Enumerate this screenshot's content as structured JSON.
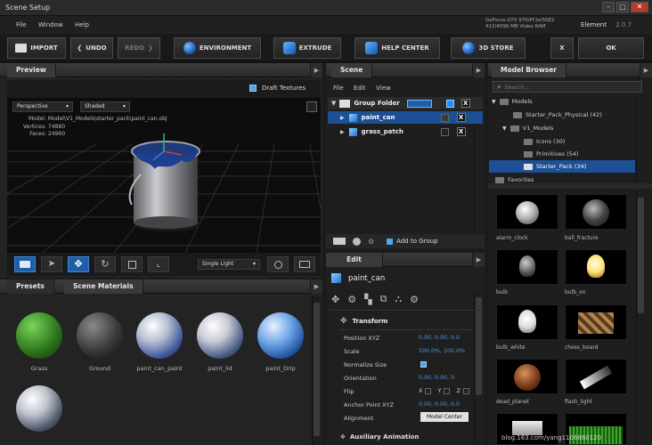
{
  "window": {
    "title": "Scene Setup"
  },
  "menu": [
    "File",
    "Window",
    "Help"
  ],
  "gpu_info": [
    "GeForce GTX 970/PCIe/SSE2",
    "412/4096 MB Video RAM"
  ],
  "app": {
    "element_label": "Element",
    "version": "2.0.7"
  },
  "toolbar": {
    "import": "IMPORT",
    "undo": "UNDO",
    "redo": "REDO",
    "environment": "ENVIRONMENT",
    "extrude": "EXTRUDE",
    "help_center": "HELP CENTER",
    "store": "3D STORE",
    "x": "X",
    "ok": "OK"
  },
  "preview": {
    "title": "Preview",
    "draft_textures": "Draft Textures",
    "projection": "Perspective",
    "shading": "Shaded",
    "model_label": "Model:",
    "model_value": "Model\\V1_Models\\starter_pack\\paint_can.obj",
    "vertices_label": "Vertices:",
    "vertices_value": "74880",
    "faces_label": "Faces:",
    "faces_value": "24960",
    "light": "Single Light"
  },
  "presets": {
    "tabs": [
      "Presets",
      "Scene Materials"
    ],
    "materials": [
      "Grass",
      "Ground",
      "paint_can_paint",
      "paint_lid",
      "paint_Drip"
    ]
  },
  "scene": {
    "title": "Scene",
    "menu": [
      "File",
      "Edit",
      "View"
    ],
    "group": "Group Folder",
    "items": [
      "paint_can",
      "grass_patch"
    ],
    "add_to_group": "Add to Group"
  },
  "edit": {
    "title": "Edit",
    "object": "paint_can",
    "section": "Transform",
    "props": {
      "position_label": "Position XYZ",
      "position_value": "0.00,  0.00,  0.0",
      "scale_label": "Scale",
      "scale_value": "100.0%,  100.0%",
      "normalize_label": "Normalize Size",
      "orientation_label": "Orientation",
      "orientation_value": "0.00,  0.00,  0",
      "flip_label": "Flip",
      "flip_x": "X",
      "flip_y": "Y",
      "flip_z": "Z",
      "anchor_label": "Anchor Point XYZ",
      "anchor_value": "0.00,  0.00,  0.0",
      "alignment_label": "Alignment",
      "alignment_value": "Model Center"
    },
    "next_section": "Auxiliary Animation"
  },
  "browser": {
    "title": "Model Browser",
    "search_placeholder": "Search...",
    "tree": [
      "Models",
      "Starter_Pack_Physical (42)",
      "V1_Models",
      "Icons (30)",
      "Primitives (54)",
      "Starter_Pack (34)",
      "Favorites"
    ],
    "thumbs": [
      "alarm_clock",
      "ball_fracture",
      "bulb",
      "bulb_on",
      "bulb_white",
      "chess_board",
      "dead_planet",
      "flash_light"
    ]
  },
  "watermark": "blog.163.com/yang1106860120",
  "colors": {
    "accent": "#1f5fa8",
    "selection": "#1c4f94",
    "value_blue": "#4c9be8"
  }
}
